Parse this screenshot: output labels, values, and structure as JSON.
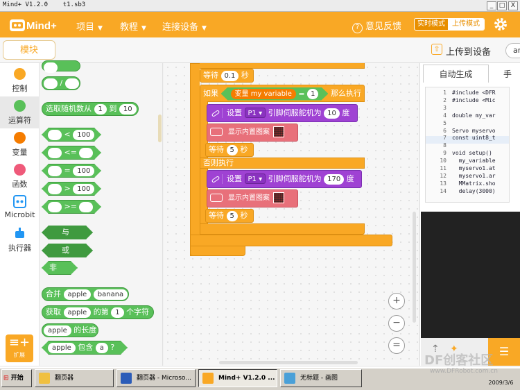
{
  "window": {
    "title": "Mind+ V1.2.0    t1.sb3",
    "min": "_",
    "max": "□",
    "close": "X"
  },
  "menubar": {
    "logo_text": "Mind+",
    "menus": [
      {
        "label": "项目"
      },
      {
        "label": "教程"
      },
      {
        "label": "连接设备"
      }
    ],
    "feedback": "意见反馈",
    "mode_realtime": "实时模式",
    "mode_upload": "上传模式",
    "icons": {
      "feedback": "question-circle-icon",
      "settings": "gear-icon"
    }
  },
  "toolbar": {
    "blocks_tab": "模块",
    "upload_to_device": "上传到设备",
    "search_value": "ar"
  },
  "categories": [
    {
      "label": "控制",
      "color": "#f9a825"
    },
    {
      "label": "运算符",
      "color": "#59c059"
    },
    {
      "label": "变量",
      "color": "#f57c00"
    },
    {
      "label": "函数",
      "color": "#ef5a7a"
    },
    {
      "label": "Microbit",
      "color": "#2196f3"
    },
    {
      "label": "执行器",
      "color": "#2196f3"
    }
  ],
  "extension_label": "扩展",
  "palette": {
    "random": {
      "prefix": "选取随机数从",
      "from": "1",
      "mid": "到",
      "to": "10"
    },
    "compare": [
      {
        "op": "<",
        "val": "100"
      },
      {
        "op": "<=",
        "val": ""
      },
      {
        "op": "=",
        "val": "100"
      },
      {
        "op": ">",
        "val": "100"
      },
      {
        "op": ">=",
        "val": ""
      }
    ],
    "and_label": "与",
    "or_label": "或",
    "not_label": "非",
    "join": {
      "prefix": "合并",
      "a": "apple",
      "b": "banana"
    },
    "letter": {
      "prefix": "获取",
      "s": "apple",
      "mid": "的第",
      "n": "1",
      "suffix": "个字符"
    },
    "length": {
      "s": "apple",
      "suffix": "的长度"
    },
    "contains": {
      "s": "apple",
      "mid": "包含",
      "t": "a",
      "suffix": "?"
    }
  },
  "script": {
    "wait1": {
      "label": "等待",
      "val": "0.1",
      "unit": "秒"
    },
    "if": {
      "label": "如果",
      "var_prefix": "变量",
      "var_name": "my variable",
      "op": "=",
      "val": "1",
      "then": "那么执行"
    },
    "servo1": {
      "label": "设置",
      "pin": "P1 ▾",
      "mid": "引脚伺服舵机为",
      "val": "10",
      "unit": "度"
    },
    "image1": {
      "label": "显示内置图案"
    },
    "wait2": {
      "label": "等待",
      "val": "5",
      "unit": "秒"
    },
    "else": {
      "label": "否则执行"
    },
    "servo2": {
      "label": "设置",
      "pin": "P1 ▾",
      "mid": "引脚伺服舵机为",
      "val": "170",
      "unit": "度"
    },
    "image2": {
      "label": "显示内置图案"
    },
    "wait3": {
      "label": "等待",
      "val": "5",
      "unit": "秒"
    }
  },
  "zoom": {
    "in": "+",
    "out": "−",
    "reset": "="
  },
  "code_panel": {
    "tab_auto": "自动生成",
    "tab_manual": "手",
    "line_numbers": [
      "1",
      "2",
      "3",
      "4",
      "5",
      "6",
      "7",
      "8",
      "9",
      "10",
      "11",
      "12",
      "13",
      "14"
    ],
    "lines": [
      "#include <DFR",
      "#include <Mic",
      "",
      "double my_var",
      "",
      "Servo myservo",
      "const uint8_t",
      "",
      "void setup()",
      "  my_variable",
      "  myservo1.at",
      "  myservo1.ar",
      "  MMatrix.sho",
      "  delay(3000)"
    ]
  },
  "taskbar": {
    "start": "开始",
    "items": [
      {
        "label": "翻页器",
        "icon_color": "#f0c040"
      },
      {
        "label": "翻页器 - Microso...",
        "icon_color": "#2b5cb8"
      },
      {
        "label": "Mind+ V1.2.0 ...",
        "icon_color": "#f9a825"
      },
      {
        "label": "无标题 - 画图",
        "icon_color": "#4aa0d8"
      }
    ],
    "clock_time": "www.DFRobot.com.cn",
    "clock_date": "2009/3/6"
  },
  "watermark": "DF创客社区"
}
